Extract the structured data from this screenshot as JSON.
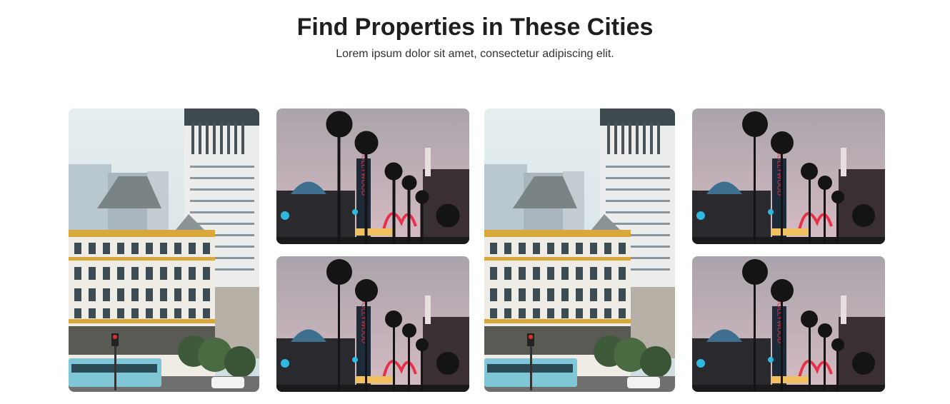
{
  "section": {
    "title": "Find Properties in These Cities",
    "subtitle": "Lorem ipsum dolor sit amet, consectetur adipiscing elit."
  },
  "city_cards": [
    {
      "image": "city-buildings-photo"
    },
    {
      "image": "hollywood-palm-trees-photo"
    },
    {
      "image": "hollywood-palm-trees-photo"
    },
    {
      "image": "city-buildings-photo"
    },
    {
      "image": "hollywood-palm-trees-photo"
    },
    {
      "image": "hollywood-palm-trees-photo"
    }
  ],
  "hollywood_sign_text": "HOLLYWOOD",
  "colors": {
    "title": "#1e1e1e",
    "subtitle": "#333333",
    "sky_day": "#dfe8ea",
    "sky_dusk": "#b8a9b0",
    "facade_gold": "#d9a83a",
    "neon_red": "#e8304a",
    "neon_blue": "#2fb8e0"
  }
}
